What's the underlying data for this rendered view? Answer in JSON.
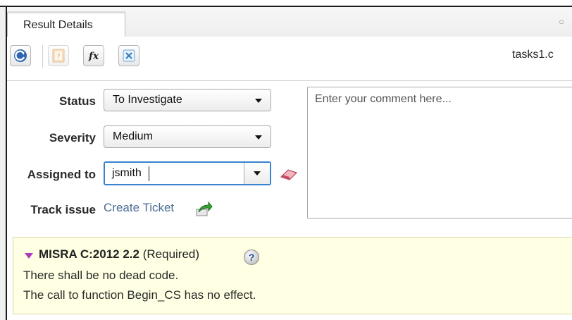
{
  "panel": {
    "tab_label": "Result Details",
    "close_glyph": "○",
    "filename": "tasks1.c"
  },
  "toolbar": {
    "buttons": [
      {
        "name": "refresh-icon"
      },
      {
        "name": "help-book-icon"
      },
      {
        "name": "function-fx-icon"
      },
      {
        "name": "close-x-icon"
      }
    ]
  },
  "form": {
    "status_label": "Status",
    "status_value": "To Investigate",
    "severity_label": "Severity",
    "severity_value": "Medium",
    "assigned_label": "Assigned to",
    "assigned_value": "jsmith",
    "track_label": "Track issue",
    "ticket_link": "Create Ticket",
    "comment_placeholder": "Enter your comment here..."
  },
  "result": {
    "rule": "MISRA C:2012 2.2",
    "requirement": "(Required)",
    "help_glyph": "?",
    "line1": "There shall be no dead code.",
    "line2": "The call to function Begin_CS has no effect."
  },
  "colors": {
    "accent_blue": "#3a83d0",
    "link": "#4a6d93",
    "info_bg": "#ffffe3",
    "disclosure_triangle": "#b23ab9"
  }
}
